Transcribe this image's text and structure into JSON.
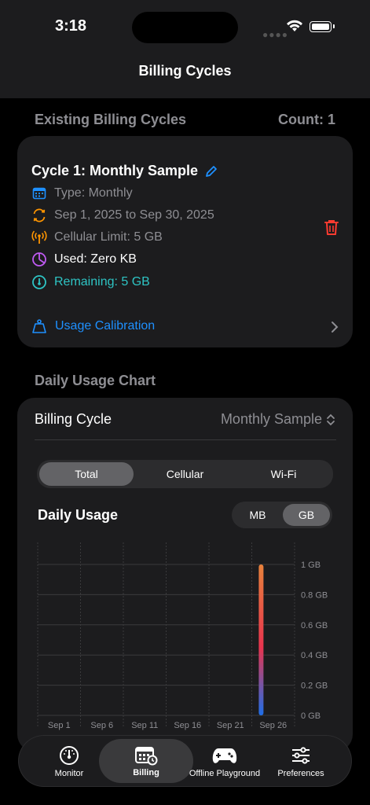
{
  "status": {
    "time": "3:18"
  },
  "nav": {
    "title": "Billing Cycles"
  },
  "existing": {
    "section_title": "Existing Billing Cycles",
    "count_label": "Count: 1",
    "cycle": {
      "title": "Cycle 1: Monthly Sample",
      "type": "Type: Monthly",
      "dates": "Sep 1, 2025 to Sep 30, 2025",
      "limit": "Cellular Limit: 5 GB",
      "used": "Used: Zero KB",
      "remaining": "Remaining: 5 GB",
      "calibration": "Usage Calibration"
    }
  },
  "chart_section": {
    "section_title": "Daily Usage Chart",
    "picker_label": "Billing Cycle",
    "picker_value": "Monthly Sample",
    "filter": [
      "Total",
      "Cellular",
      "Wi-Fi"
    ],
    "filter_selected": 0,
    "chart_title": "Daily Usage",
    "units": [
      "MB",
      "GB"
    ],
    "unit_selected": 1
  },
  "chart_data": {
    "type": "bar",
    "title": "Daily Usage",
    "x_ticks": [
      "Sep 1",
      "Sep 6",
      "Sep 11",
      "Sep 16",
      "Sep 21",
      "Sep 26"
    ],
    "y_ticks": [
      "1 GB",
      "0.8 GB",
      "0.6 GB",
      "0.4 GB",
      "0.2 GB",
      "0 GB"
    ],
    "ylim": [
      0,
      1
    ],
    "bars": [
      {
        "day": 27,
        "value": 1.0
      }
    ],
    "colors": {
      "top": "#e8823c",
      "mid": "#e8344e",
      "bottom": "#1e6ee8"
    },
    "grid": true
  },
  "tabs": [
    {
      "label": "Monitor",
      "icon": "gauge-icon"
    },
    {
      "label": "Billing",
      "icon": "billing-calendar-icon"
    },
    {
      "label": "Offline Playground",
      "icon": "gamecontroller-icon"
    },
    {
      "label": "Preferences",
      "icon": "sliders-icon"
    }
  ],
  "tab_selected": 1,
  "colors": {
    "accent": "#1e90ff",
    "teal": "#2ec4c4",
    "delete": "#ff3b30",
    "orange": "#ff9500",
    "purple": "#bf5af2"
  }
}
